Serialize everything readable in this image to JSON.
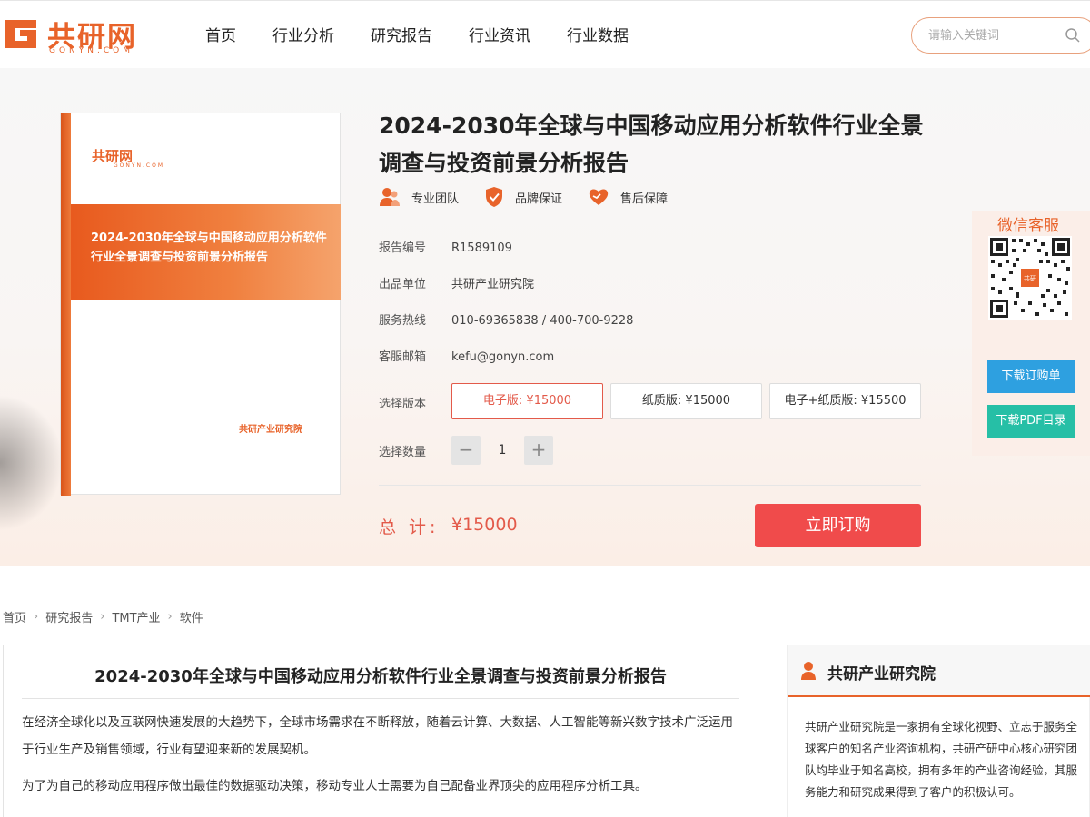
{
  "header": {
    "logo_text": "共研网",
    "logo_sub": "GONYN.COM",
    "nav": [
      "首页",
      "行业分析",
      "研究报告",
      "行业资讯",
      "行业数据"
    ],
    "search_placeholder": "请输入关键词"
  },
  "book": {
    "logo_text": "共研网",
    "logo_sub": "GONYN.COM",
    "title": "2024-2030年全球与中国移动应用分析软件行业全景调查与投资前景分析报告",
    "publisher": "共研产业研究院"
  },
  "product": {
    "title": "2024-2030年全球与中国移动应用分析软件行业全景调查与投资前景分析报告",
    "badges": [
      "专业团队",
      "品牌保证",
      "售后保障"
    ],
    "info": [
      {
        "label": "报告编号",
        "value": "R1589109"
      },
      {
        "label": "出品单位",
        "value": "共研产业研究院"
      },
      {
        "label": "服务热线",
        "value": "010-69365838 / 400-700-9228"
      },
      {
        "label": "客服邮箱",
        "value": "kefu@gonyn.com"
      }
    ],
    "version_label": "选择版本",
    "versions": [
      "电子版: ¥15000",
      "纸质版: ¥15000",
      "电子+纸质版: ¥15500"
    ],
    "quantity_label": "选择数量",
    "quantity_minus": "−",
    "quantity": "1",
    "quantity_plus": "+",
    "total_label": "总 计:",
    "total_value": "¥15000",
    "order_button": "立即订购"
  },
  "float_panel": {
    "title": "微信客服",
    "qr_center": "共研",
    "download_order": "下载订购单",
    "download_pdf": "下载PDF目录"
  },
  "breadcrumb": [
    "首页",
    "研究报告",
    "TMT产业",
    "软件"
  ],
  "article": {
    "title": "2024-2030年全球与中国移动应用分析软件行业全景调查与投资前景分析报告",
    "p1": "在经济全球化以及互联网快速发展的大趋势下，全球市场需求在不断释放，随着云计算、大数据、人工智能等新兴数字技术广泛运用于行业生产及销售领域，行业有望迎来新的发展契机。",
    "p2": "为了为自己的移动应用程序做出最佳的数据驱动决策，移动专业人士需要为自己配备业界顶尖的应用程序分析工具。"
  },
  "sidebar": {
    "title": "共研产业研究院",
    "text": "共研产业研究院是一家拥有全球化视野、立志于服务全球客户的知名产业咨询机构，共研产研中心核心研究团队均毕业于知名高校，拥有多年的产业咨询经验，其服务能力和研究成果得到了客户的积极认可。"
  },
  "colors": {
    "brand": "#e8632a",
    "price": "#e35a4a",
    "order_button": "#f04b4b",
    "download_order": "#2ea0e0",
    "download_pdf": "#26bfa6"
  }
}
